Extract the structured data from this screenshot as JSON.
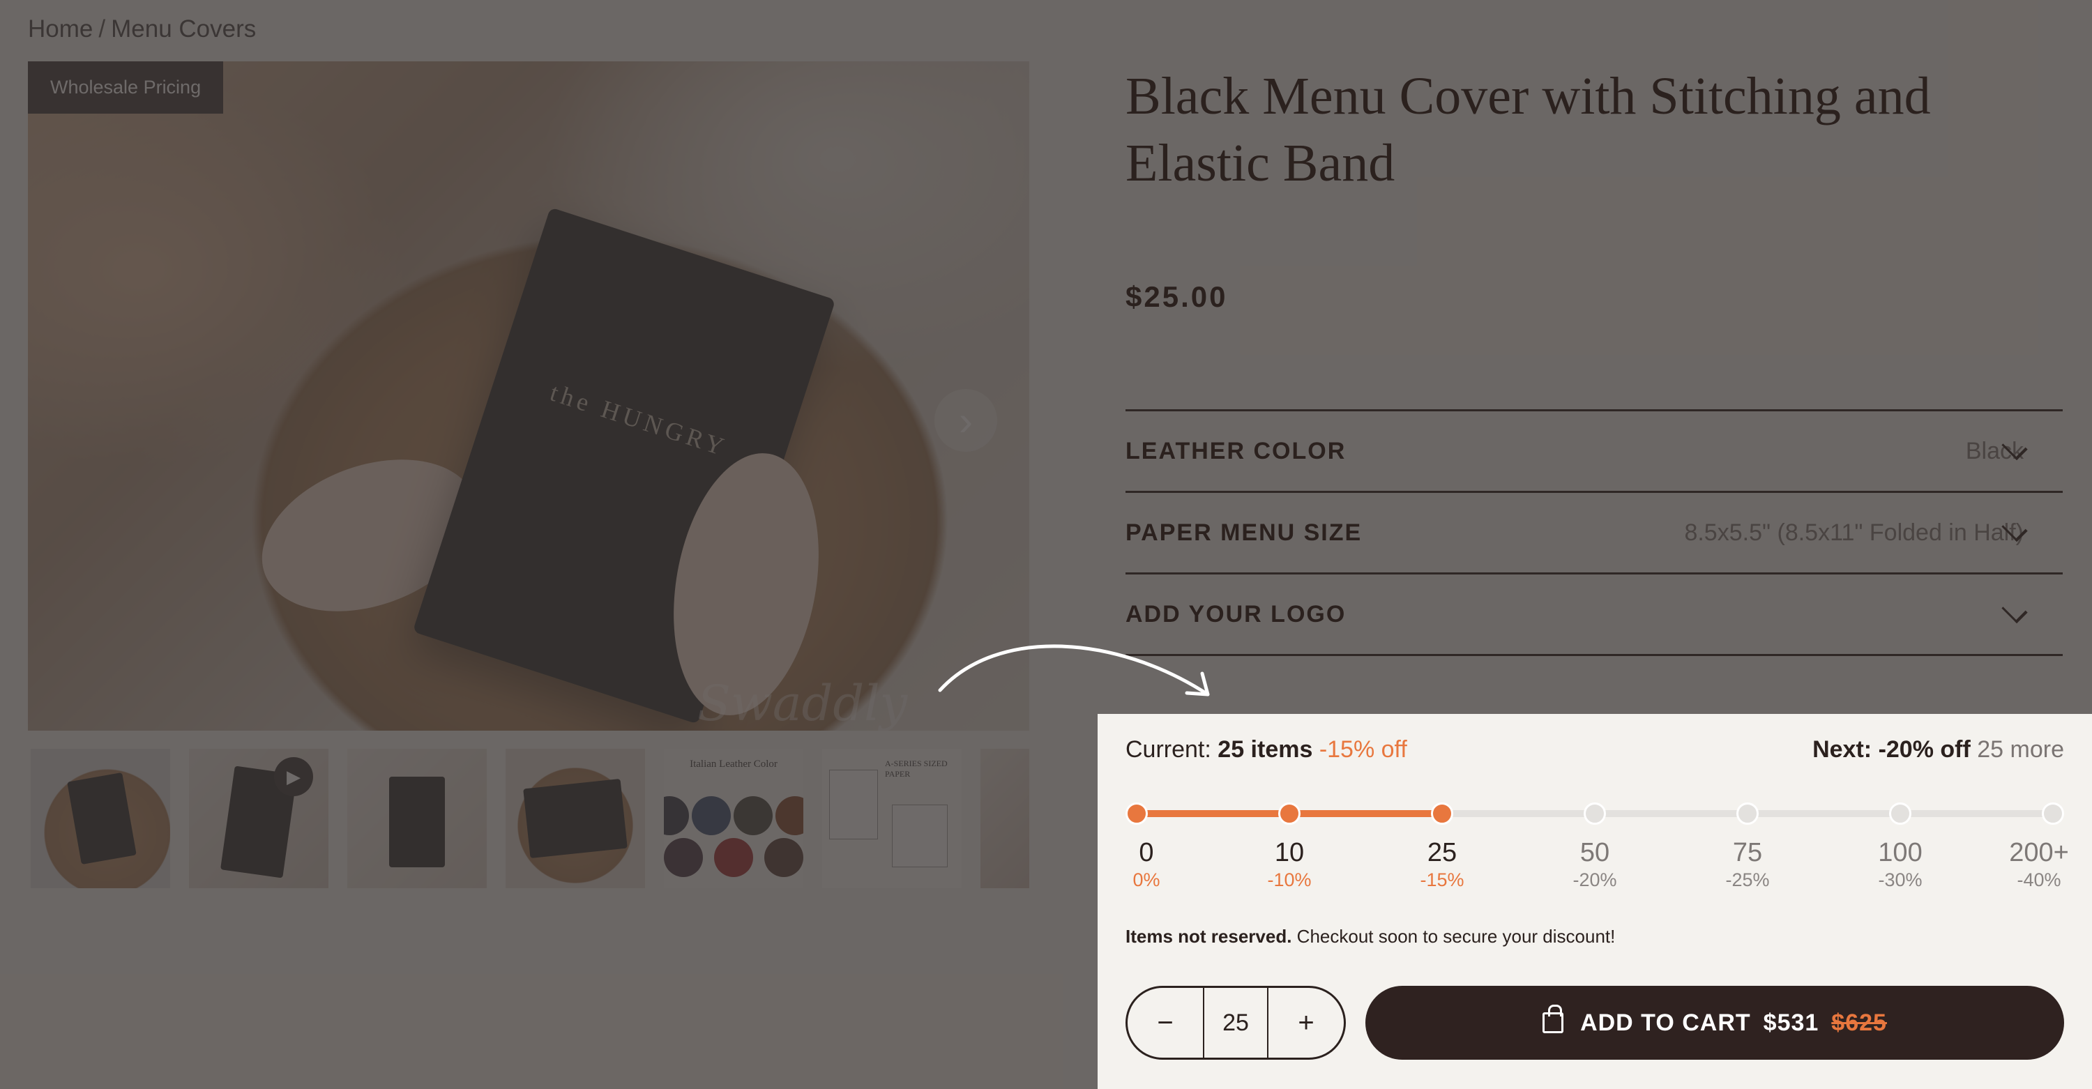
{
  "breadcrumb": {
    "home": "Home",
    "separator": "/",
    "current": "Menu Covers"
  },
  "gallery": {
    "badge": "Wholesale Pricing",
    "next_icon": "chevron-right-icon",
    "book_text": "the HUNGRY",
    "thumb_leather_caption": "Italian Leather Color",
    "thumb_paper_caption": "A-SERIES SIZED PAPER"
  },
  "product": {
    "title": "Black Menu Cover with Stitching and Elastic Band",
    "price": "$25.00"
  },
  "options": [
    {
      "label": "LEATHER COLOR",
      "value": "Black"
    },
    {
      "label": "PAPER MENU SIZE",
      "value": "8.5x5.5\" (8.5x11\" Folded in Half)"
    },
    {
      "label": "ADD YOUR LOGO",
      "value": ""
    }
  ],
  "discount": {
    "current_label": "Current:",
    "current_items": "25 items",
    "current_off": "-15% off",
    "next_label": "Next:",
    "next_off": "-20% off",
    "next_more": "25 more",
    "progress_fraction": 0.333,
    "tiers": [
      {
        "qty": "0",
        "pct": "0%",
        "reached": true
      },
      {
        "qty": "10",
        "pct": "-10%",
        "reached": true
      },
      {
        "qty": "25",
        "pct": "-15%",
        "reached": true
      },
      {
        "qty": "50",
        "pct": "-20%",
        "reached": false
      },
      {
        "qty": "75",
        "pct": "-25%",
        "reached": false
      },
      {
        "qty": "100",
        "pct": "-30%",
        "reached": false
      },
      {
        "qty": "200+",
        "pct": "-40%",
        "reached": false
      }
    ],
    "note_bold": "Items not reserved.",
    "note_text": "Checkout soon to secure your discount!"
  },
  "cart": {
    "minus": "−",
    "quantity": "25",
    "plus": "+",
    "add_label": "ADD TO CART",
    "price_now": "$531",
    "price_old": "$625"
  },
  "colors": {
    "accent": "#e8773e",
    "dark": "#2f2220",
    "overlay": "#3c3634"
  }
}
